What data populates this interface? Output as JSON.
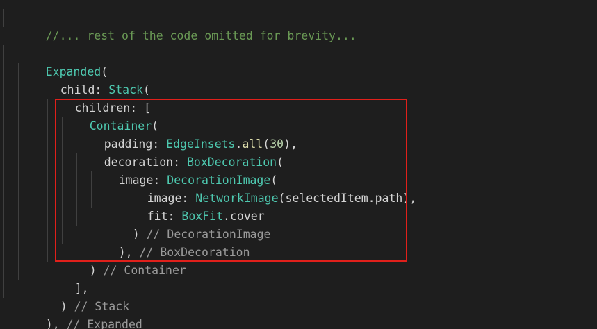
{
  "editor": {
    "background": "#1e1e1e",
    "colors": {
      "comment": "#6a9955",
      "close_comment": "#9a9a9a",
      "class_name": "#4ec9b0",
      "method": "#dcdcaa",
      "number": "#b5cea8",
      "plain": "#d4d4d4",
      "highlight_border": "#e0201b"
    },
    "lines": [
      [
        "//... rest of the code omitted for brevity..."
      ],
      [
        ""
      ],
      [
        "Expanded",
        "("
      ],
      [
        "child: ",
        "Stack",
        "("
      ],
      [
        "children: ["
      ],
      [
        "Container",
        "("
      ],
      [
        "padding: ",
        "EdgeInsets",
        ".",
        "all",
        "(",
        "30",
        "),"
      ],
      [
        "decoration: ",
        "BoxDecoration",
        "("
      ],
      [
        "image: ",
        "DecorationImage",
        "("
      ],
      [
        "image: ",
        "NetworkImage",
        "(selectedItem.path),"
      ],
      [
        "fit: ",
        "BoxFit",
        ".cover"
      ],
      [
        ") ",
        "// DecorationImage"
      ],
      [
        "), ",
        "// BoxDecoration"
      ],
      [
        ") ",
        "// Container"
      ],
      [
        "],"
      ],
      [
        ") ",
        "// Stack"
      ],
      [
        "), ",
        "// Expanded"
      ]
    ]
  }
}
